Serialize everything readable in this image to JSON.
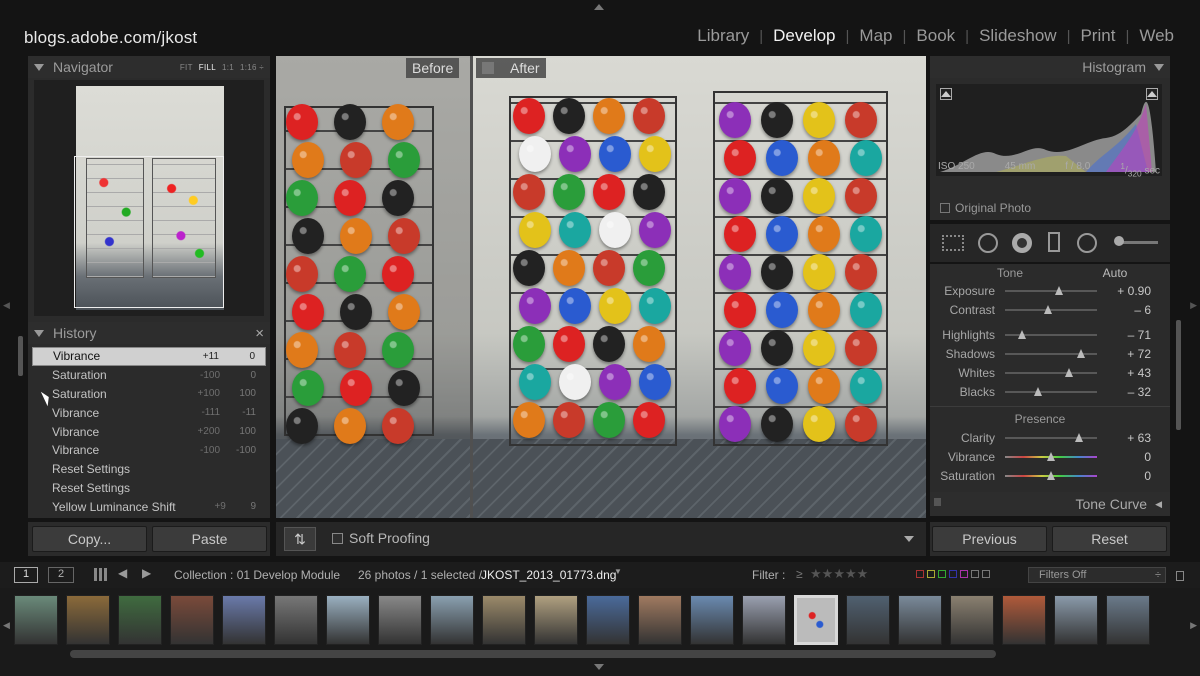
{
  "header": {
    "brand": "blogs.adobe.com/jkost",
    "modules": [
      {
        "label": "Library"
      },
      {
        "label": "Develop",
        "active": true
      },
      {
        "label": "Map"
      },
      {
        "label": "Book"
      },
      {
        "label": "Slideshow"
      },
      {
        "label": "Print"
      },
      {
        "label": "Web"
      }
    ]
  },
  "navigator": {
    "title": "Navigator",
    "options": [
      "FIT",
      "FILL",
      "1:1",
      "1:16 ÷"
    ],
    "active_option": "FILL"
  },
  "history": {
    "title": "History",
    "close": "×",
    "items": [
      {
        "name": "Vibrance",
        "a": "+11",
        "b": "0",
        "selected": true
      },
      {
        "name": "Saturation",
        "a": "-100",
        "b": "0"
      },
      {
        "name": "Saturation",
        "a": "+100",
        "b": "100"
      },
      {
        "name": "Vibrance",
        "a": "-111",
        "b": "-11"
      },
      {
        "name": "Vibrance",
        "a": "+200",
        "b": "100"
      },
      {
        "name": "Vibrance",
        "a": "-100",
        "b": "-100"
      },
      {
        "name": "Reset Settings",
        "a": "",
        "b": ""
      },
      {
        "name": "Reset Settings",
        "a": "",
        "b": ""
      },
      {
        "name": "Yellow Luminance Shift",
        "a": "+9",
        "b": "9"
      }
    ]
  },
  "left_buttons": {
    "copy": "Copy...",
    "paste": "Paste"
  },
  "viewer": {
    "before": "Before",
    "after": "After",
    "soft_proofing": "Soft Proofing"
  },
  "histogram": {
    "title": "Histogram",
    "iso": "ISO 250",
    "focal": "45 mm",
    "aperture": "f / 8.0",
    "shutter_num": "1",
    "shutter_den": "320",
    "shutter_unit": "sec",
    "original_photo": "Original Photo"
  },
  "basic": {
    "tone_title": "Tone",
    "auto": "Auto",
    "tone": [
      {
        "label": "Exposure",
        "value": "+ 0.90",
        "pos": 0.59
      },
      {
        "label": "Contrast",
        "value": "– 6",
        "pos": 0.47
      }
    ],
    "tone2": [
      {
        "label": "Highlights",
        "value": "– 71",
        "pos": 0.18
      },
      {
        "label": "Shadows",
        "value": "+ 72",
        "pos": 0.83
      },
      {
        "label": "Whites",
        "value": "+ 43",
        "pos": 0.7
      },
      {
        "label": "Blacks",
        "value": "– 32",
        "pos": 0.36
      }
    ],
    "presence_title": "Presence",
    "presence": [
      {
        "label": "Clarity",
        "value": "+ 63",
        "pos": 0.8
      },
      {
        "label": "Vibrance",
        "value": "0",
        "pos": 0.5
      },
      {
        "label": "Saturation",
        "value": "0",
        "pos": 0.5
      }
    ],
    "tone_curve": "Tone Curve"
  },
  "right_buttons": {
    "previous": "Previous",
    "reset": "Reset"
  },
  "status": {
    "page1": "1",
    "page2": "2",
    "collection": "Collection : 01 Develop Module",
    "count": "26 photos / 1 selected /",
    "filename": "JKOST_2013_01773.dng",
    "filter_label": "Filter :",
    "filter_cmp": "≥",
    "filters_off": "Filters Off"
  },
  "colors": {
    "accent": "#e0e0e0",
    "panel": "#2b2b2b",
    "background": "#141414"
  }
}
